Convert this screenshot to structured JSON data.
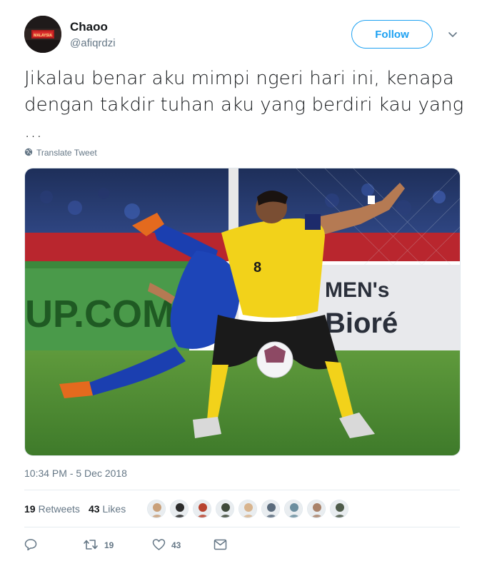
{
  "user": {
    "name": "Chaoo",
    "handle": "@afiqrdzi",
    "avatar_text": "MALAYSIA"
  },
  "header": {
    "follow_label": "Follow"
  },
  "tweet": {
    "text": "Jikalau benar aku mimpi ngeri hari ini, kenapa dengan takdir tuhan aku yang berdiri kau yang ...",
    "translate_label": "Translate Tweet",
    "timestamp": "10:34 PM - 5 Dec 2018"
  },
  "media": {
    "banner_left": "UP.COM",
    "banner_right_top": "MEN's",
    "banner_right_bottom": "Bioré",
    "jersey_number": "8"
  },
  "stats": {
    "retweets_count": "19",
    "retweets_label": "Retweets",
    "likes_count": "43",
    "likes_label": "Likes"
  },
  "likers": [
    "#c9a07a",
    "#2b2b2b",
    "#b8432f",
    "#3f4a3a",
    "#d8b48e",
    "#5a6b7c",
    "#6b8e9f",
    "#a9826a",
    "#4e5b4a"
  ],
  "actions": {
    "reply_count": "",
    "retweet_count": "19",
    "like_count": "43"
  },
  "colors": {
    "accent": "#1da1f2",
    "secondary_text": "#657786",
    "primary_text": "#14171a"
  },
  "icons": [
    "globe-icon",
    "caret-down-icon",
    "reply-icon",
    "retweet-icon",
    "like-icon",
    "message-icon"
  ]
}
